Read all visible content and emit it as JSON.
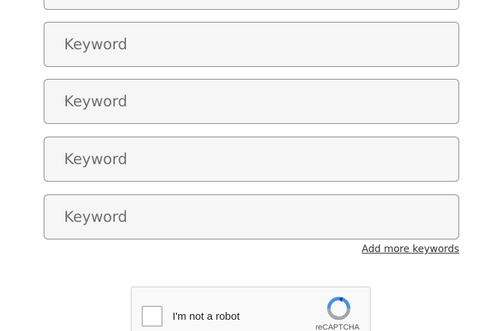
{
  "keywords": {
    "placeholder": "Keyword",
    "fields": [
      {
        "value": ""
      },
      {
        "value": ""
      },
      {
        "value": ""
      },
      {
        "value": ""
      },
      {
        "value": ""
      }
    ],
    "add_more_label": "Add more keywords"
  },
  "recaptcha": {
    "checkbox_label": "I'm not a robot",
    "brand": "reCAPTCHA",
    "checked": false,
    "logo_icon": "recaptcha-logo-icon"
  },
  "colors": {
    "field_border": "#8a8a8a",
    "field_background": "#f6f6f6",
    "placeholder_text": "#6f6f6f",
    "recaptcha_blue": "#4a90e2",
    "recaptcha_gray": "#a6a6a6"
  }
}
